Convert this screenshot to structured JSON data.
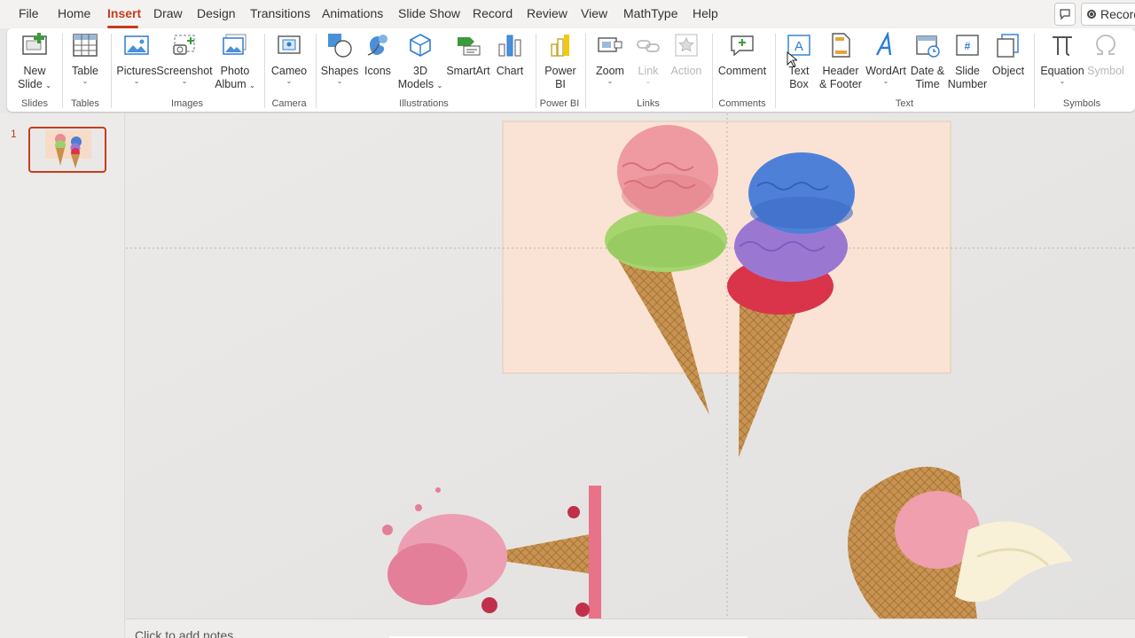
{
  "menu": {
    "tabs": [
      "File",
      "Home",
      "Insert",
      "Draw",
      "Design",
      "Transitions",
      "Animations",
      "Slide Show",
      "Record",
      "Review",
      "View",
      "MathType",
      "Help"
    ],
    "active_tab": "Insert",
    "record_label": "Record"
  },
  "ribbon": {
    "slides": {
      "new_slide_l1": "New",
      "new_slide_l2": "Slide",
      "group": "Slides"
    },
    "tables": {
      "table": "Table",
      "group": "Tables"
    },
    "images": {
      "pictures": "Pictures",
      "screenshot": "Screenshot",
      "photo_l1": "Photo",
      "photo_l2": "Album",
      "group": "Images"
    },
    "camera": {
      "cameo": "Cameo",
      "group": "Camera"
    },
    "illustrations": {
      "shapes": "Shapes",
      "icons": "Icons",
      "models_l1": "3D",
      "models_l2": "Models",
      "smartart": "SmartArt",
      "chart": "Chart",
      "group": "Illustrations"
    },
    "powerbi": {
      "l1": "Power",
      "l2": "BI",
      "group": "Power BI"
    },
    "links": {
      "zoom": "Zoom",
      "link": "Link",
      "action": "Action",
      "group": "Links"
    },
    "comments": {
      "comment": "Comment",
      "group": "Comments"
    },
    "text": {
      "textbox_l1": "Text",
      "textbox_l2": "Box",
      "header_l1": "Header",
      "header_l2": "& Footer",
      "wordart": "WordArt",
      "datetime_l1": "Date &",
      "datetime_l2": "Time",
      "slidenum_l1": "Slide",
      "slidenum_l2": "Number",
      "object": "Object",
      "group": "Text"
    },
    "symbols": {
      "equation": "Equation",
      "symbol": "Symbol",
      "group": "Symbols"
    }
  },
  "thumbnails": {
    "slide_number": "1"
  },
  "notes": {
    "placeholder": "Click to add notes"
  },
  "colors": {
    "accent": "#c43e1c",
    "slide_bg": "#fae3d4",
    "canvas_bg": "#e6e5e3",
    "ribbon_icon_blue": "#2b7cd3"
  }
}
